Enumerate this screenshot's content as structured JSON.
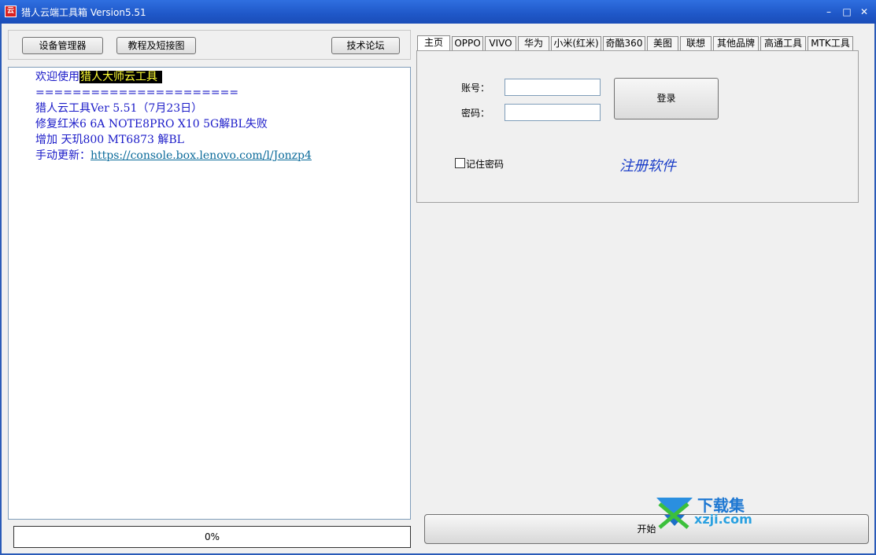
{
  "window": {
    "title": "猎人云端工具箱 Version5.51",
    "icon_char": "云",
    "controls": {
      "minimize": "–",
      "maximize": "□",
      "close": "✕"
    }
  },
  "toolbar": {
    "device_manager": "设备管理器",
    "tutorial": "教程及短接图",
    "forum": "技术论坛"
  },
  "log": {
    "welcome_prefix": "欢迎使用",
    "welcome_highlight": "猎人大师云工具",
    "separator": "======================",
    "version_line": "猎人云工具Ver 5.51（7月23日）",
    "fix_line": "修复红米6 6A NOTE8PRO X10 5G解BL失败",
    "add_line": "增加 天玑800 MT6873 解BL",
    "update_prefix": "手动更新：",
    "update_link": "https://console.box.lenovo.com/l/Jonzp4"
  },
  "progress": {
    "label": "0%",
    "value": 0
  },
  "tabs": [
    {
      "label": "主页",
      "active": true
    },
    {
      "label": "OPPO"
    },
    {
      "label": "VIVO"
    },
    {
      "label": "华为"
    },
    {
      "label": "小米(红米)"
    },
    {
      "label": "奇酷360"
    },
    {
      "label": "美图"
    },
    {
      "label": "联想"
    },
    {
      "label": "其他品牌"
    },
    {
      "label": "高通工具"
    },
    {
      "label": "MTK工具"
    }
  ],
  "login": {
    "account_label": "账号：",
    "account_value": "",
    "password_label": "密码：",
    "password_value": "",
    "login_button": "登录",
    "remember_label": "记住密码",
    "remember_checked": false,
    "register_link": "注册软件"
  },
  "start_button": "开始",
  "watermark": {
    "text": "下载集",
    "domain": "xzji.com"
  }
}
